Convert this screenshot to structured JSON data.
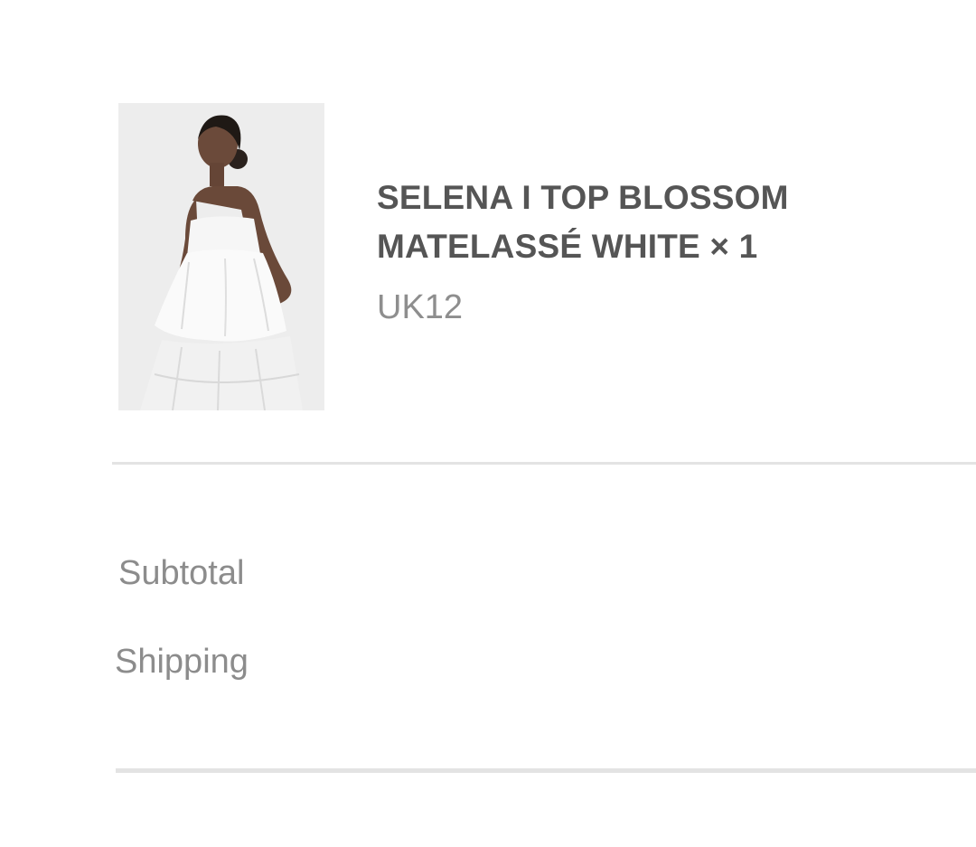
{
  "cart_item": {
    "image_alt": "product-photo",
    "title_line1": "SELENA I TOP BLOSSOM",
    "title_line2": "MATELASSÉ WHITE × 1",
    "variant": "UK12"
  },
  "summary": {
    "subtotal_label": "Subtotal",
    "shipping_label": "Shipping"
  }
}
